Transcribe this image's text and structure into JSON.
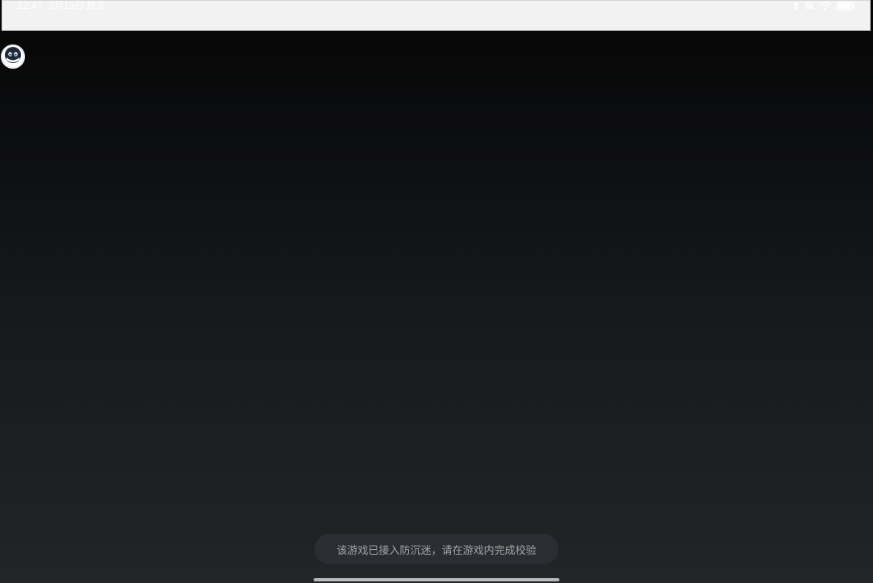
{
  "status_bar": {
    "time": "12:47",
    "date": "3月13日 周五"
  },
  "icons": {
    "bluetooth": "bluetooth-icon",
    "mute": "mute-icon",
    "wifi": "wifi-icon",
    "battery": "battery-icon",
    "floating_avatar": "mascot-face-icon"
  },
  "toast": {
    "message": "该游戏已接入防沉迷，请在游戏内完成校验"
  },
  "colors": {
    "background_top": "#050505",
    "background_bottom": "#222528",
    "toast_bg": "#2a2d31",
    "toast_text": "#a4a6a9",
    "status_bar_bg": "#f2f2f2"
  }
}
